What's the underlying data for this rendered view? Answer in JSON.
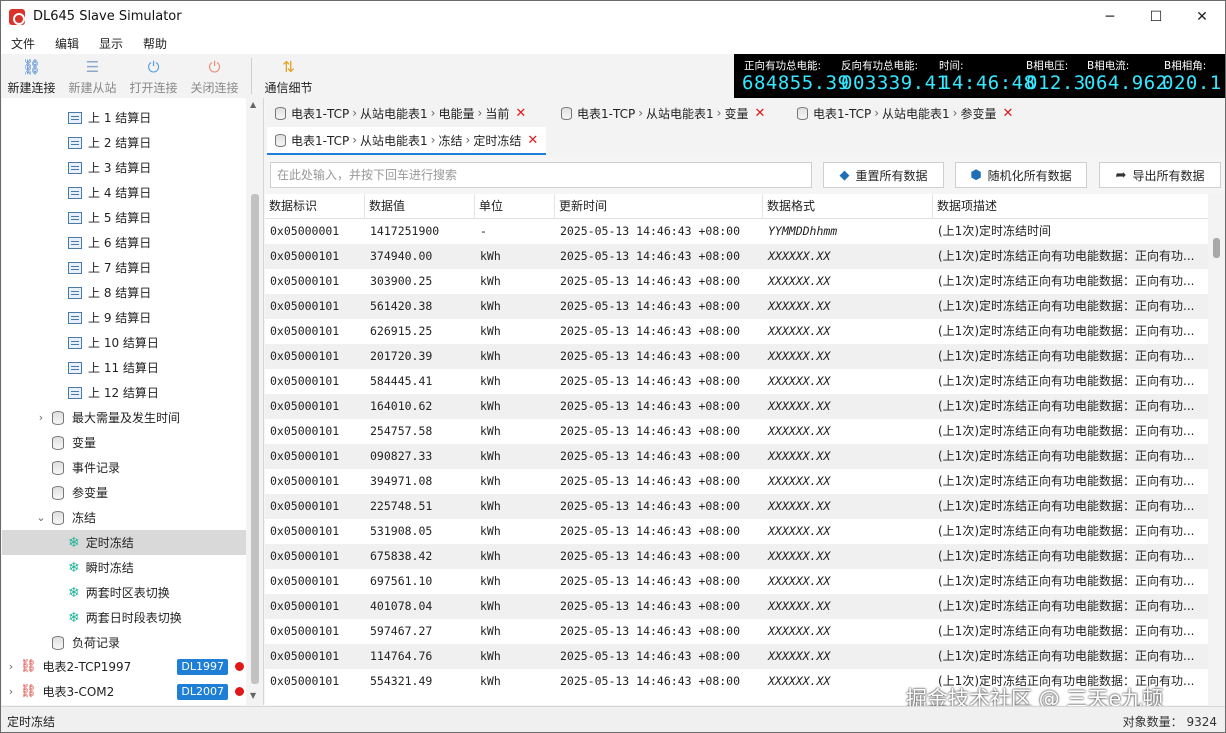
{
  "window": {
    "title": "DL645 Slave Simulator",
    "min": "─",
    "max": "☐",
    "close": "✕"
  },
  "menu": [
    "文件",
    "编辑",
    "显示",
    "帮助"
  ],
  "toolbar": {
    "new_connection": "新建连接",
    "new_slave": "新建从站",
    "open_connection": "打开连接",
    "close_connection": "关闭连接",
    "comm_detail": "通信细节"
  },
  "readout": {
    "fwd_label": "正向有功总电能:",
    "fwd_value": "684855.39",
    "rev_label": "反向有功总电能:",
    "rev_value": "003339.41",
    "time_label": "时间:",
    "time_value": "14:46:48",
    "bv_label": "B相电压:",
    "bv_value": "012.3",
    "bi_label": "B相电流:",
    "bi_value": "064.962",
    "ba_label": "B相相角:",
    "ba_value": "020.1"
  },
  "tree": {
    "settlements": [
      "上 1 结算日",
      "上 2 结算日",
      "上 3 结算日",
      "上 4 结算日",
      "上 5 结算日",
      "上 6 结算日",
      "上 7 结算日",
      "上 8 结算日",
      "上 9 结算日",
      "上 10 结算日",
      "上 11 结算日",
      "上 12 结算日"
    ],
    "max_demand": "最大需量及发生时间",
    "variables": "变量",
    "events": "事件记录",
    "params": "参变量",
    "freeze": "冻结",
    "freeze_items": [
      "定时冻结",
      "瞬时冻结",
      "两套时区表切换",
      "两套日时段表切换"
    ],
    "load_record": "负荷记录",
    "meter2": "电表2-TCP1997",
    "meter2_badge": "DL1997",
    "meter3": "电表3-COM2",
    "meter3_badge": "DL2007"
  },
  "tabs": [
    {
      "parts": [
        "电表1-TCP",
        "从站电能表1",
        "电能量",
        "当前"
      ]
    },
    {
      "parts": [
        "电表1-TCP",
        "从站电能表1",
        "变量"
      ]
    },
    {
      "parts": [
        "电表1-TCP",
        "从站电能表1",
        "参变量"
      ]
    },
    {
      "parts": [
        "电表1-TCP",
        "从站电能表1",
        "冻结",
        "定时冻结"
      ]
    }
  ],
  "search": {
    "placeholder": "在此处输入，并按下回车进行搜索"
  },
  "actions": {
    "reset_all": "重置所有数据",
    "randomize_all": "随机化所有数据",
    "export_all": "导出所有数据"
  },
  "grid": {
    "columns": [
      "数据标识",
      "数据值",
      "单位",
      "更新时间",
      "数据格式",
      "数据项描述"
    ],
    "rows": [
      [
        "0x05000001",
        "1417251900",
        "-",
        "2025-05-13 14:46:43 +08:00",
        "YYMMDDhhmm",
        "(上1次)定时冻结时间"
      ],
      [
        "0x05000101",
        "374940.00",
        "kWh",
        "2025-05-13 14:46:43 +08:00",
        "XXXXXX.XX",
        "(上1次)定时冻结正向有功电能数据：正向有功..."
      ],
      [
        "0x05000101",
        "303900.25",
        "kWh",
        "2025-05-13 14:46:43 +08:00",
        "XXXXXX.XX",
        "(上1次)定时冻结正向有功电能数据：正向有功..."
      ],
      [
        "0x05000101",
        "561420.38",
        "kWh",
        "2025-05-13 14:46:43 +08:00",
        "XXXXXX.XX",
        "(上1次)定时冻结正向有功电能数据：正向有功..."
      ],
      [
        "0x05000101",
        "626915.25",
        "kWh",
        "2025-05-13 14:46:43 +08:00",
        "XXXXXX.XX",
        "(上1次)定时冻结正向有功电能数据：正向有功..."
      ],
      [
        "0x05000101",
        "201720.39",
        "kWh",
        "2025-05-13 14:46:43 +08:00",
        "XXXXXX.XX",
        "(上1次)定时冻结正向有功电能数据：正向有功..."
      ],
      [
        "0x05000101",
        "584445.41",
        "kWh",
        "2025-05-13 14:46:43 +08:00",
        "XXXXXX.XX",
        "(上1次)定时冻结正向有功电能数据：正向有功..."
      ],
      [
        "0x05000101",
        "164010.62",
        "kWh",
        "2025-05-13 14:46:43 +08:00",
        "XXXXXX.XX",
        "(上1次)定时冻结正向有功电能数据：正向有功..."
      ],
      [
        "0x05000101",
        "254757.58",
        "kWh",
        "2025-05-13 14:46:43 +08:00",
        "XXXXXX.XX",
        "(上1次)定时冻结正向有功电能数据：正向有功..."
      ],
      [
        "0x05000101",
        "090827.33",
        "kWh",
        "2025-05-13 14:46:43 +08:00",
        "XXXXXX.XX",
        "(上1次)定时冻结正向有功电能数据：正向有功..."
      ],
      [
        "0x05000101",
        "394971.08",
        "kWh",
        "2025-05-13 14:46:43 +08:00",
        "XXXXXX.XX",
        "(上1次)定时冻结正向有功电能数据：正向有功..."
      ],
      [
        "0x05000101",
        "225748.51",
        "kWh",
        "2025-05-13 14:46:43 +08:00",
        "XXXXXX.XX",
        "(上1次)定时冻结正向有功电能数据：正向有功..."
      ],
      [
        "0x05000101",
        "531908.05",
        "kWh",
        "2025-05-13 14:46:43 +08:00",
        "XXXXXX.XX",
        "(上1次)定时冻结正向有功电能数据：正向有功..."
      ],
      [
        "0x05000101",
        "675838.42",
        "kWh",
        "2025-05-13 14:46:43 +08:00",
        "XXXXXX.XX",
        "(上1次)定时冻结正向有功电能数据：正向有功..."
      ],
      [
        "0x05000101",
        "697561.10",
        "kWh",
        "2025-05-13 14:46:43 +08:00",
        "XXXXXX.XX",
        "(上1次)定时冻结正向有功电能数据：正向有功..."
      ],
      [
        "0x05000101",
        "401078.04",
        "kWh",
        "2025-05-13 14:46:43 +08:00",
        "XXXXXX.XX",
        "(上1次)定时冻结正向有功电能数据：正向有功..."
      ],
      [
        "0x05000101",
        "597467.27",
        "kWh",
        "2025-05-13 14:46:43 +08:00",
        "XXXXXX.XX",
        "(上1次)定时冻结正向有功电能数据：正向有功..."
      ],
      [
        "0x05000101",
        "114764.76",
        "kWh",
        "2025-05-13 14:46:43 +08:00",
        "XXXXXX.XX",
        "(上1次)定时冻结正向有功电能数据：正向有功..."
      ],
      [
        "0x05000101",
        "554321.49",
        "kWh",
        "2025-05-13 14:46:43 +08:00",
        "XXXXXX.XX",
        "(上1次)定时冻结正向有功电能数据：正向有功..."
      ]
    ]
  },
  "status": {
    "left": "定时冻结",
    "right": "对象数量： 9324"
  },
  "watermark": "掘金技术社区 @ 三天e九顿"
}
